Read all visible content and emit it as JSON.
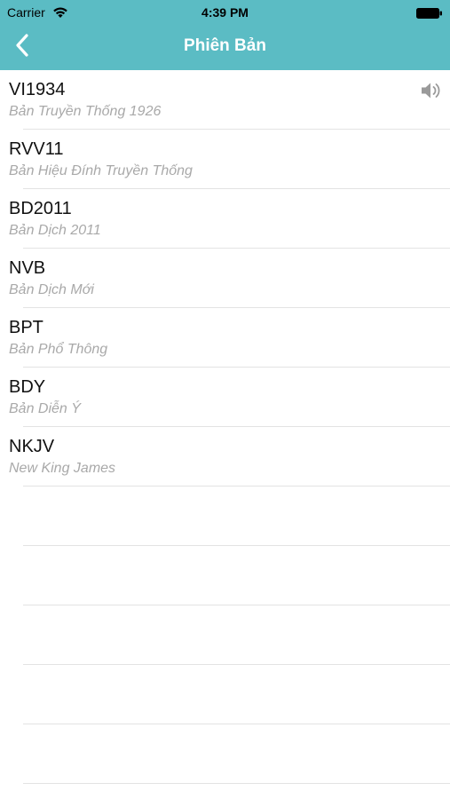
{
  "status_bar": {
    "carrier": "Carrier",
    "time": "4:39 PM",
    "icons": [
      "wifi-icon",
      "battery-icon"
    ]
  },
  "nav_bar": {
    "title": "Phiên Bản",
    "back_icon": "chevron-left-icon",
    "background_color": "#5bbcc4"
  },
  "versions": [
    {
      "code": "VI1934",
      "name": "Bản Truyền Thống 1926",
      "has_audio": true
    },
    {
      "code": "RVV11",
      "name": "Bản Hiệu Đính Truyền Thống",
      "has_audio": false
    },
    {
      "code": "BD2011",
      "name": "Bản Dịch 2011",
      "has_audio": false
    },
    {
      "code": "NVB",
      "name": "Bản Dịch Mới",
      "has_audio": false
    },
    {
      "code": "BPT",
      "name": "Bản Phổ Thông",
      "has_audio": false
    },
    {
      "code": "BDY",
      "name": "Bản Diễn Ý",
      "has_audio": false
    },
    {
      "code": "NKJV",
      "name": "New King James",
      "has_audio": false
    }
  ]
}
